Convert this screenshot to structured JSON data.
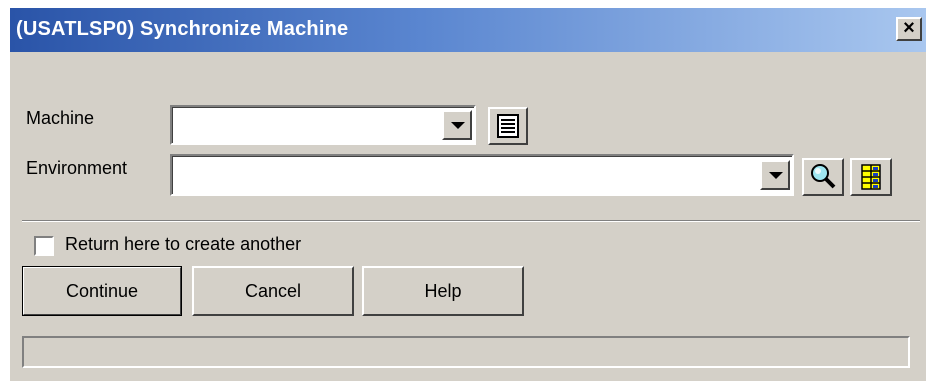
{
  "window": {
    "title": "(USATLSP0) Synchronize Machine",
    "close_glyph": "×"
  },
  "form": {
    "machine": {
      "label": "Machine",
      "value": ""
    },
    "environment": {
      "label": "Environment",
      "value": ""
    }
  },
  "icons": {
    "machine_list": "list-icon",
    "search": "magnifier-icon",
    "grid": "grid-icon"
  },
  "options": {
    "return_here_label": "Return here to create another",
    "return_here_checked": false
  },
  "buttons": {
    "continue": "Continue",
    "cancel": "Cancel",
    "help": "Help"
  },
  "status": {
    "text": ""
  },
  "colors": {
    "title_gradient_start": "#2a54a8",
    "title_gradient_end": "#a9c7ef",
    "face": "#d4d0c8"
  }
}
